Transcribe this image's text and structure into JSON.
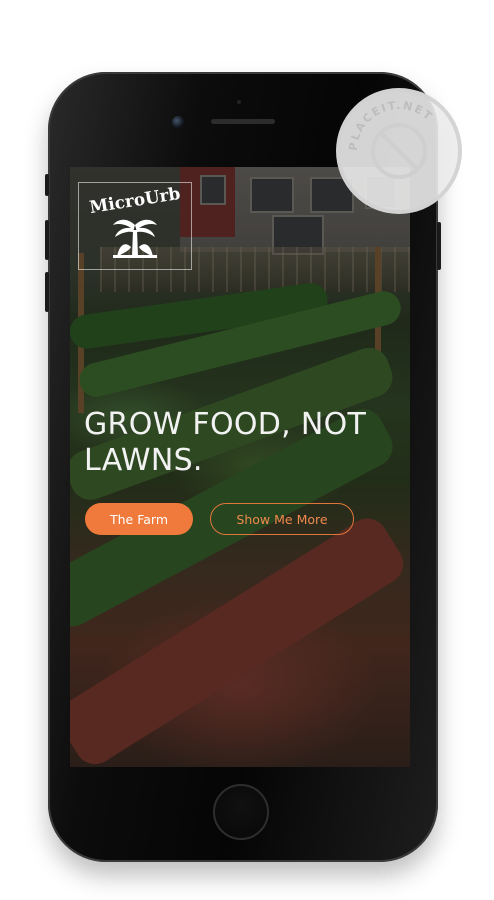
{
  "site": {
    "logo_text": "MicroUrb",
    "headline": "GROW FOOD, NOT LAWNS.",
    "buttons": {
      "primary_label": "The Farm",
      "secondary_label": "Show Me More"
    }
  },
  "watermark": {
    "text": "PLACEIT.NET"
  },
  "colors": {
    "accent": "#f07a3b",
    "phone_body": "#0a0a0a",
    "headline": "#f2f2f2"
  },
  "icons": [
    "palm-tree-logo-icon",
    "watermark-no-icon"
  ]
}
